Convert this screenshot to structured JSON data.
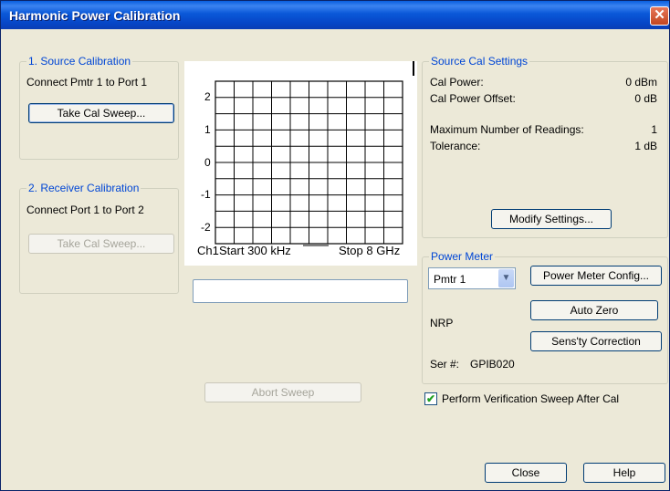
{
  "window": {
    "title": "Harmonic Power Calibration",
    "close_glyph": "✕"
  },
  "source_cal": {
    "legend": "1. Source Calibration",
    "instruction": "Connect Pmtr 1 to Port 1",
    "button": "Take Cal Sweep..."
  },
  "receiver_cal": {
    "legend": "2. Receiver Calibration",
    "instruction": "Connect Port 1 to Port 2",
    "button": "Take Cal Sweep..."
  },
  "plot": {
    "y_ticks": [
      "2",
      "1",
      "0",
      "-1",
      "-2"
    ],
    "channel": "Ch1",
    "start_label": "Start 300 kHz",
    "stop_label": "Stop 8 GHz"
  },
  "status_box": {
    "value": ""
  },
  "abort_button": "Abort Sweep",
  "settings": {
    "legend": "Source Cal Settings",
    "cal_power_label": "Cal Power:",
    "cal_power_value": "0 dBm",
    "offset_label": "Cal Power Offset:",
    "offset_value": "0 dB",
    "max_readings_label": "Maximum Number of Readings:",
    "max_readings_value": "1",
    "tolerance_label": "Tolerance:",
    "tolerance_value": "1 dB",
    "modify_button": "Modify Settings..."
  },
  "power_meter": {
    "legend": "Power Meter",
    "selected": "Pmtr 1",
    "config_button": "Power Meter Config...",
    "model": "NRP",
    "auto_zero_button": "Auto Zero",
    "sens_button": "Sens'ty Correction",
    "serial_label": "Ser #:",
    "serial_value": "GPIB020"
  },
  "verify": {
    "label": "Perform Verification Sweep After Cal",
    "checked": true,
    "check_glyph": "✔"
  },
  "footer": {
    "close": "Close",
    "help": "Help"
  }
}
